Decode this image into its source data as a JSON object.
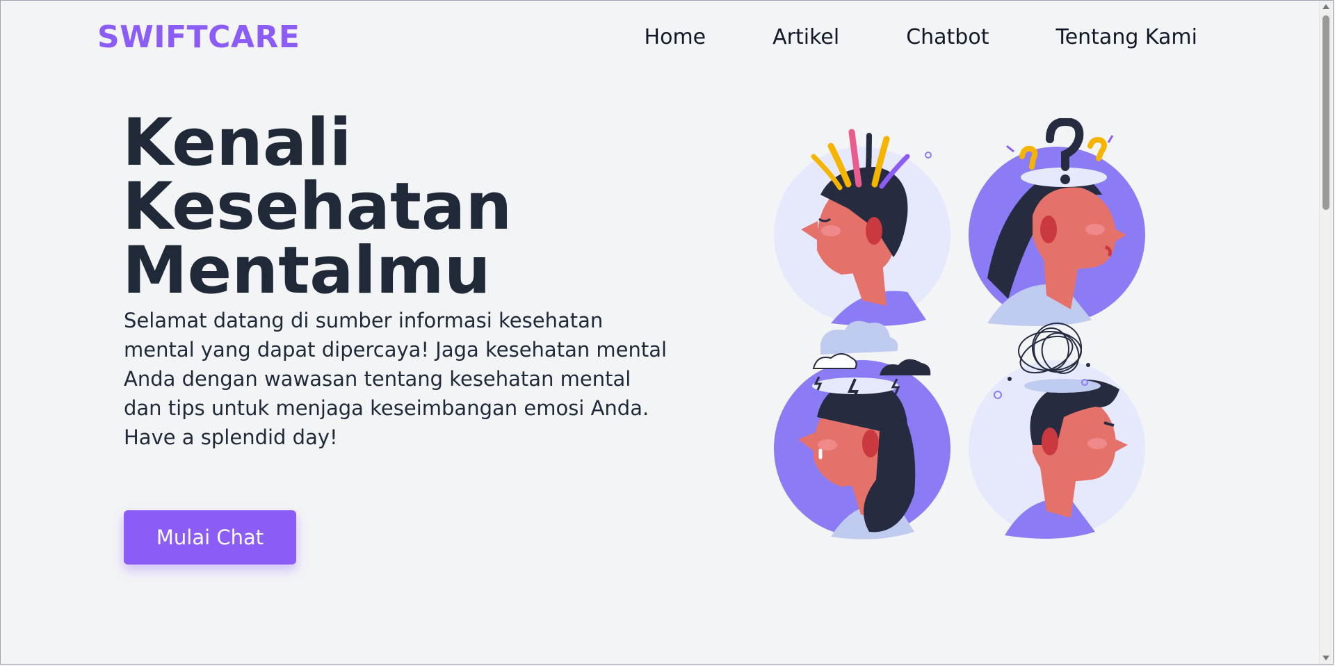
{
  "brand": {
    "logo_text": "SWIFTCARE"
  },
  "nav": {
    "items": [
      {
        "label": "Home"
      },
      {
        "label": "Artikel"
      },
      {
        "label": "Chatbot"
      },
      {
        "label": "Tentang Kami"
      }
    ]
  },
  "hero": {
    "title_line1": "Kenali",
    "title_line2": "Kesehatan",
    "title_line3": "Mentalmu",
    "description": "Selamat datang di sumber informasi kesehatan mental yang dapat dipercaya! Jaga kesehatan mental Anda dengan wawasan tentang kesehatan mental dan tips untuk menjaga keseimbangan emosi Anda.",
    "greeting": "Have a splendid day!",
    "cta_label": "Mulai Chat"
  },
  "illustration": {
    "panels": [
      {
        "icon": "flowers-head-icon"
      },
      {
        "icon": "question-marks-head-icon"
      },
      {
        "icon": "storm-cloud-head-icon"
      },
      {
        "icon": "tangled-thoughts-head-icon"
      }
    ]
  },
  "colors": {
    "accent": "#8b5cf6",
    "text_dark": "#1f2937",
    "background": "#f3f4f6",
    "panel_light": "#e6e9fb",
    "panel_purple": "#8b7cf6",
    "skin": "#e5726a",
    "hair": "#262b3f"
  }
}
